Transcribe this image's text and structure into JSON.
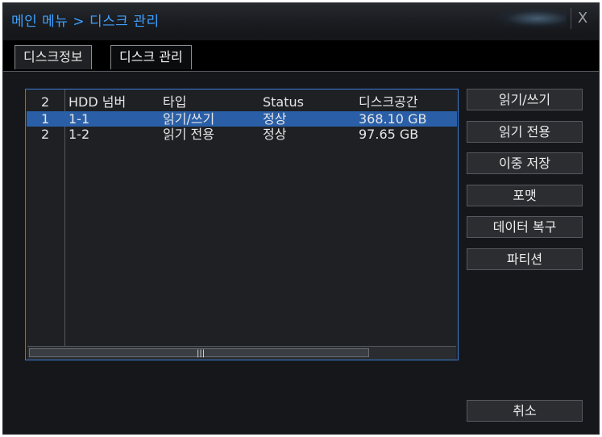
{
  "window": {
    "title": "메인 메뉴 > 디스크 관리",
    "close_label": "X"
  },
  "tabs": [
    {
      "label": "디스크정보",
      "active": false
    },
    {
      "label": "디스크 관리",
      "active": true
    }
  ],
  "table": {
    "headers": [
      "2",
      "HDD 넘버",
      "타입",
      "Status",
      "디스크공간"
    ],
    "rows": [
      {
        "index": "1",
        "hdd": "1-1",
        "type": "읽기/쓰기",
        "status": "정상",
        "space": "368.10 GB",
        "selected": true
      },
      {
        "index": "2",
        "hdd": "1-2",
        "type": "읽기 전용",
        "status": "정상",
        "space": "97.65 GB",
        "selected": false
      }
    ],
    "scrollbar_grip": "|||"
  },
  "actions": {
    "read_write": "읽기/쓰기",
    "read_only": "읽기 전용",
    "redundant": "이중 저장",
    "format": "포맷",
    "recover": "데이터 복구",
    "partition": "파티션",
    "cancel": "취소"
  },
  "colors": {
    "accent": "#3fa1ff",
    "selection": "#2a5fa8",
    "frame": "#3c7dd6"
  }
}
